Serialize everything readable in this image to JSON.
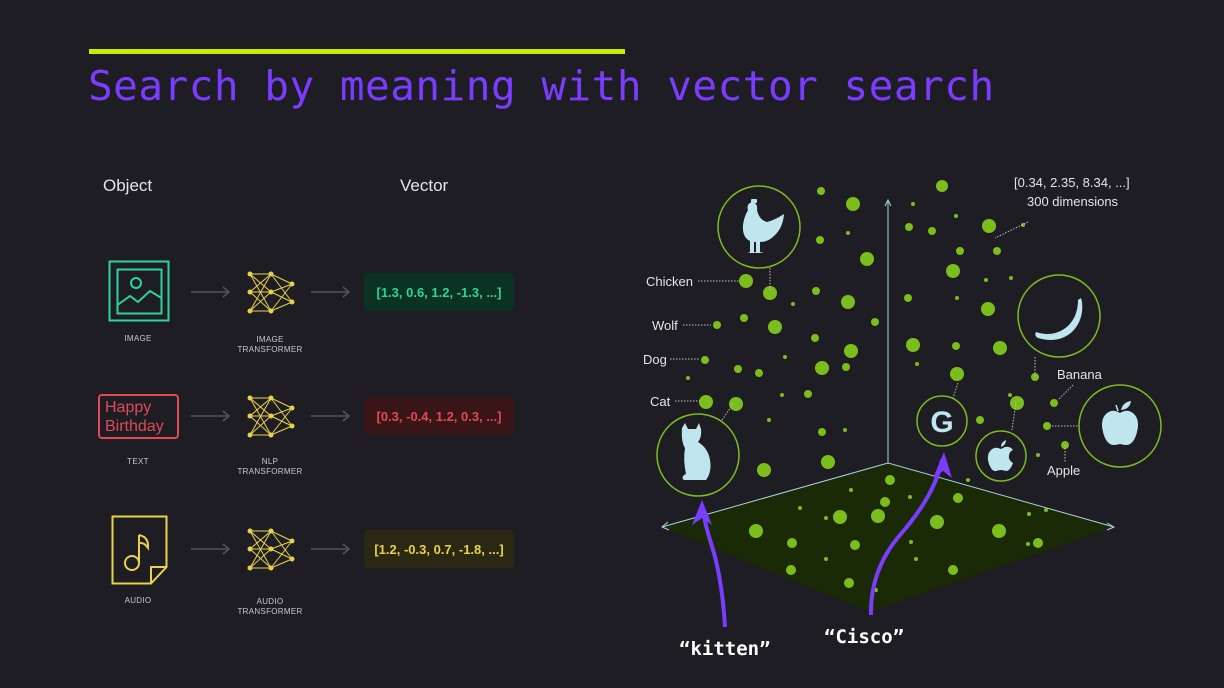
{
  "title": "Search by meaning with vector search",
  "colors": {
    "accent_bar": "#c6ef00",
    "title": "#7a3cff",
    "image": "#2ed39a",
    "text": "#e04a55",
    "audio": "#e8d24a",
    "dot": "#7cbd1e",
    "icon_fill": "#bfe6ef",
    "query_arrow": "#7a3cff"
  },
  "left_panel": {
    "object_header": "Object",
    "vector_header": "Vector",
    "rows": [
      {
        "object_label": "IMAGE",
        "transformer_label_1": "IMAGE",
        "transformer_label_2": "TRANSFORMER",
        "vector": "[1.3, 0.6, 1.2, -1.3, ...]"
      },
      {
        "object_label": "TEXT",
        "object_text_1": "Happy",
        "object_text_2": "Birthday",
        "transformer_label_1": "NLP",
        "transformer_label_2": "TRANSFORMER",
        "vector": "[0.3, -0.4, 1.2, 0.3, ...]"
      },
      {
        "object_label": "AUDIO",
        "transformer_label_1": "AUDIO",
        "transformer_label_2": "TRANSFORMER",
        "vector": "[1.2, -0.3, 0.7, -1.8, ...]"
      }
    ]
  },
  "vector_space": {
    "labels": {
      "chicken": "Chicken",
      "wolf": "Wolf",
      "dog": "Dog",
      "cat": "Cat",
      "banana": "Banana",
      "apple": "Apple",
      "vector_example": "[0.34, 2.35, 8.34, ...]",
      "dimensions": "300 dimensions"
    },
    "icons": [
      "chicken-icon",
      "cat-icon",
      "google-icon",
      "apple-logo-icon",
      "banana-icon",
      "apple-fruit-icon"
    ],
    "queries": [
      {
        "text": "“kitten”",
        "target": "cat"
      },
      {
        "text": "“Cisco”",
        "target": "google"
      }
    ]
  }
}
